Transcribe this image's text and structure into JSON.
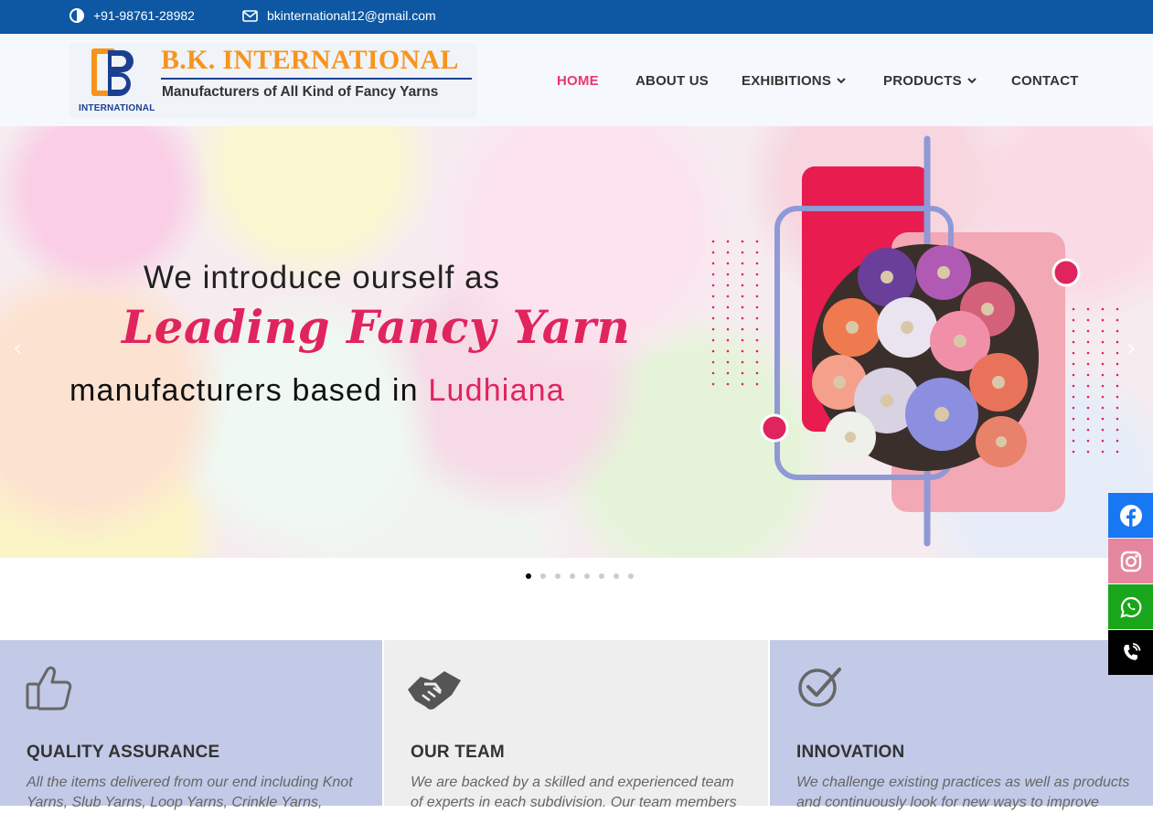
{
  "topbar": {
    "phone": "+91-98761-28982",
    "email": "bkinternational12@gmail.com"
  },
  "logo": {
    "title": "B.K. INTERNATIONAL",
    "tagline": "Manufacturers of All Kind of Fancy Yarns",
    "sub": "INTERNATIONAL"
  },
  "nav": {
    "home": "HOME",
    "about": "ABOUT US",
    "exhibitions": "EXHIBITIONS",
    "products": "PRODUCTS",
    "contact": "CONTACT"
  },
  "hero": {
    "line1": "We introduce ourself as",
    "line2": "Leading Fancy Yarn",
    "line3": "manufacturers based in",
    "line3_highlight": "Ludhiana",
    "slides_total": 8,
    "slide_active": 1
  },
  "features": [
    {
      "title": "QUALITY ASSURANCE",
      "text": "All the items delivered from our end including Knot Yarns, Slub Yarns, Loop Yarns, Crinkle Yarns,"
    },
    {
      "title": "OUR TEAM",
      "text": "We are backed by a skilled and experienced team of experts in each subdivision. Our team members"
    },
    {
      "title": "INNOVATION",
      "text": "We challenge existing practices as well as products and continuously look for new ways to improve"
    }
  ],
  "colors": {
    "topbar": "#0d57a3",
    "accent": "#e8386d",
    "card_blue": "#c2cae8",
    "card_grey": "#efeeee",
    "facebook": "#1877f2",
    "instagram": "#e4879e",
    "whatsapp": "#1aa61a",
    "phone": "#000000"
  },
  "icons": [
    "contrast-icon",
    "mail-icon",
    "chevron-down-icon",
    "thumbs-up-icon",
    "handshake-icon",
    "check-circle-icon",
    "facebook-icon",
    "instagram-icon",
    "whatsapp-icon",
    "phone-icon"
  ]
}
